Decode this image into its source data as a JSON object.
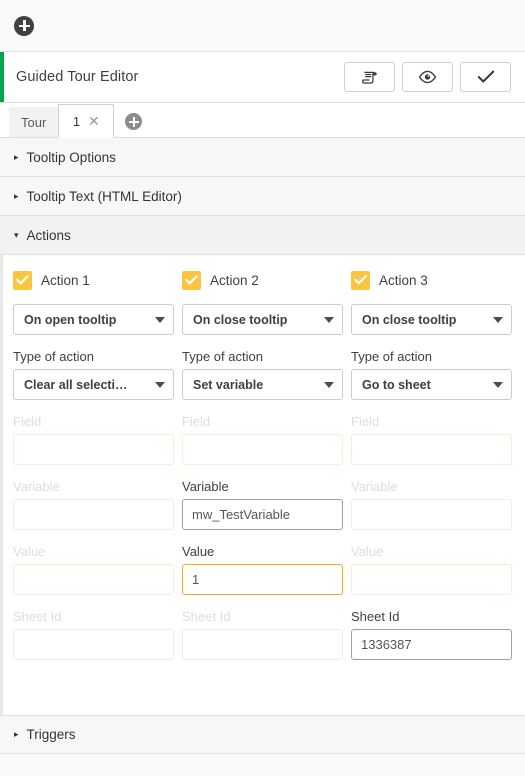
{
  "toolbar": {
    "add_icon": "circle-plus-icon"
  },
  "header": {
    "title": "Guided Tour Editor",
    "accent_color": "#00a64f",
    "buttons": [
      {
        "name": "scroll-button",
        "icon": "scroll-icon"
      },
      {
        "name": "preview-button",
        "icon": "eye-icon"
      },
      {
        "name": "confirm-button",
        "icon": "check-icon"
      }
    ]
  },
  "tabs": {
    "group_label": "Tour",
    "active_tab": "1",
    "close_glyph": "✕",
    "add_icon": "circle-plus-icon"
  },
  "sections": [
    {
      "label": "Tooltip Options",
      "expanded": false,
      "caret": "▸"
    },
    {
      "label": "Tooltip Text (HTML Editor)",
      "expanded": false,
      "caret": "▸"
    },
    {
      "label": "Actions",
      "expanded": true,
      "caret": "▾"
    }
  ],
  "footer_sections": [
    {
      "label": "Triggers",
      "expanded": false,
      "caret": "▸"
    }
  ],
  "labels": {
    "type_of_action": "Type of action",
    "field": "Field",
    "variable": "Variable",
    "value": "Value",
    "sheet_id": "Sheet Id"
  },
  "actions": [
    {
      "checkbox_label": "Action 1",
      "checked": true,
      "trigger": "On open tooltip",
      "type_of_action": "Clear all selecti…",
      "field_value": "",
      "field_enabled": false,
      "variable_value": "",
      "variable_enabled": false,
      "value_value": "",
      "value_enabled": false,
      "sheet_id_value": "",
      "sheet_id_enabled": false
    },
    {
      "checkbox_label": "Action 2",
      "checked": true,
      "trigger": "On close tooltip",
      "type_of_action": "Set variable",
      "field_value": "",
      "field_enabled": false,
      "variable_value": "mw_TestVariable",
      "variable_enabled": true,
      "value_value": "1",
      "value_enabled": true,
      "value_focused": true,
      "sheet_id_value": "",
      "sheet_id_enabled": false
    },
    {
      "checkbox_label": "Action 3",
      "checked": true,
      "trigger": "On close tooltip",
      "type_of_action": "Go to sheet",
      "field_value": "",
      "field_enabled": false,
      "variable_value": "",
      "variable_enabled": false,
      "value_value": "",
      "value_enabled": false,
      "sheet_id_value": "1336387",
      "sheet_id_enabled": true
    }
  ],
  "colors": {
    "checkbox": "#fbc540",
    "focus_border": "#f5a623",
    "accent_green": "#00a64f"
  }
}
